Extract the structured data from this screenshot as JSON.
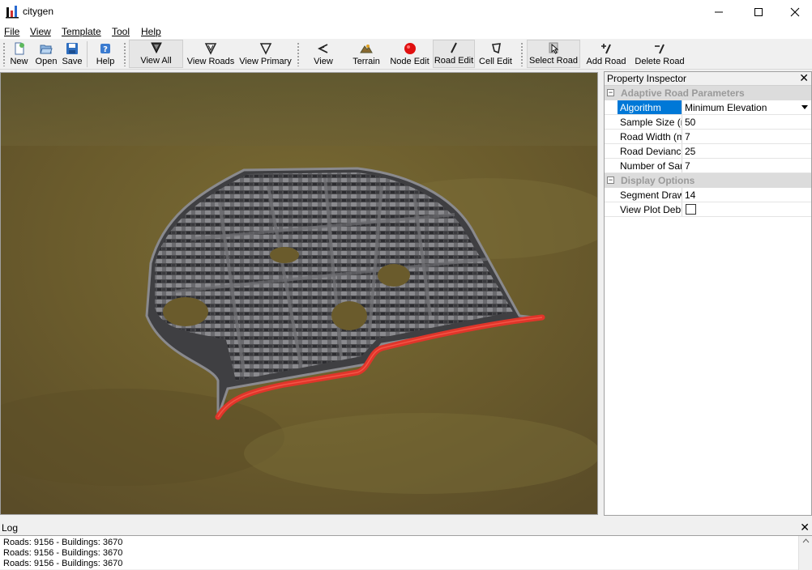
{
  "window": {
    "title": "citygen"
  },
  "menu": [
    {
      "label": "File"
    },
    {
      "label": "View"
    },
    {
      "label": "Template"
    },
    {
      "label": "Tool"
    },
    {
      "label": "Help"
    }
  ],
  "toolbar": {
    "new": "New",
    "open": "Open",
    "save": "Save",
    "help": "Help",
    "view_all": "View All",
    "view_roads": "View Roads",
    "view_primary": "View Primary",
    "view": "View",
    "terrain": "Terrain",
    "node_edit": "Node Edit",
    "road_edit": "Road Edit",
    "cell_edit": "Cell Edit",
    "select_road": "Select Road",
    "add_road": "Add Road",
    "delete_road": "Delete Road"
  },
  "inspector": {
    "title": "Property Inspector",
    "groups": [
      {
        "label": "Adaptive Road Parameters",
        "rows": [
          {
            "name": "Algorithm",
            "value": "Minimum Elevation"
          },
          {
            "name": "Sample Size (m)",
            "value": "50"
          },
          {
            "name": "Road Width (m)",
            "value": "7"
          },
          {
            "name": "Road Deviance",
            "value": "25"
          },
          {
            "name": "Number of Samples",
            "value": "7"
          }
        ]
      },
      {
        "label": "Display Options",
        "rows": [
          {
            "name": "Segment Draw Size",
            "value": "14"
          },
          {
            "name": "View Plot Debug",
            "value": ""
          }
        ]
      }
    ]
  },
  "log": {
    "title": "Log",
    "lines": [
      "Roads: 9156 - Buildings: 3670",
      "Roads: 9156 - Buildings: 3670",
      "Roads: 9156 - Buildings: 3670"
    ]
  },
  "colors": {
    "selected_road": "#e0352a",
    "terrain": "#6e6030",
    "accent": "#0078d7"
  }
}
